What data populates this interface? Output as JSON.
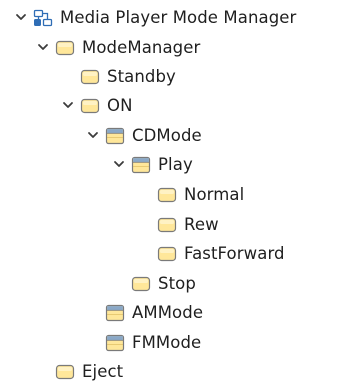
{
  "tree": {
    "items": [
      {
        "label": "Media Player Mode Manager",
        "icon": "state-machine-icon",
        "expanded": true,
        "has_children": true,
        "level": 0
      },
      {
        "label": "ModeManager",
        "icon": "state-icon",
        "expanded": true,
        "has_children": true,
        "level": 1
      },
      {
        "label": "Standby",
        "icon": "state-icon",
        "expanded": false,
        "has_children": false,
        "level": 2
      },
      {
        "label": "ON",
        "icon": "state-icon",
        "expanded": true,
        "has_children": true,
        "level": 2
      },
      {
        "label": "CDMode",
        "icon": "composite-state-icon",
        "expanded": true,
        "has_children": true,
        "level": 3
      },
      {
        "label": "Play",
        "icon": "composite-state-icon",
        "expanded": true,
        "has_children": true,
        "level": 4
      },
      {
        "label": "Normal",
        "icon": "state-icon",
        "expanded": false,
        "has_children": false,
        "level": 5
      },
      {
        "label": "Rew",
        "icon": "state-icon",
        "expanded": false,
        "has_children": false,
        "level": 5
      },
      {
        "label": "FastForward",
        "icon": "state-icon",
        "expanded": false,
        "has_children": false,
        "level": 5
      },
      {
        "label": "Stop",
        "icon": "state-icon",
        "expanded": false,
        "has_children": false,
        "level": 4
      },
      {
        "label": "AMMode",
        "icon": "composite-state-icon",
        "expanded": false,
        "has_children": false,
        "level": 3
      },
      {
        "label": "FMMode",
        "icon": "composite-state-icon",
        "expanded": false,
        "has_children": false,
        "level": 3
      },
      {
        "label": "Eject",
        "icon": "state-icon",
        "expanded": false,
        "has_children": false,
        "level": 1
      }
    ]
  },
  "colors": {
    "text": "#1f1f1f",
    "chevron": "#3c3c3c",
    "state_fill": "#ffe79a",
    "state_border": "#7a7a7a",
    "composite_header": "#8aa8c8",
    "machine_blue": "#2f6db5"
  }
}
